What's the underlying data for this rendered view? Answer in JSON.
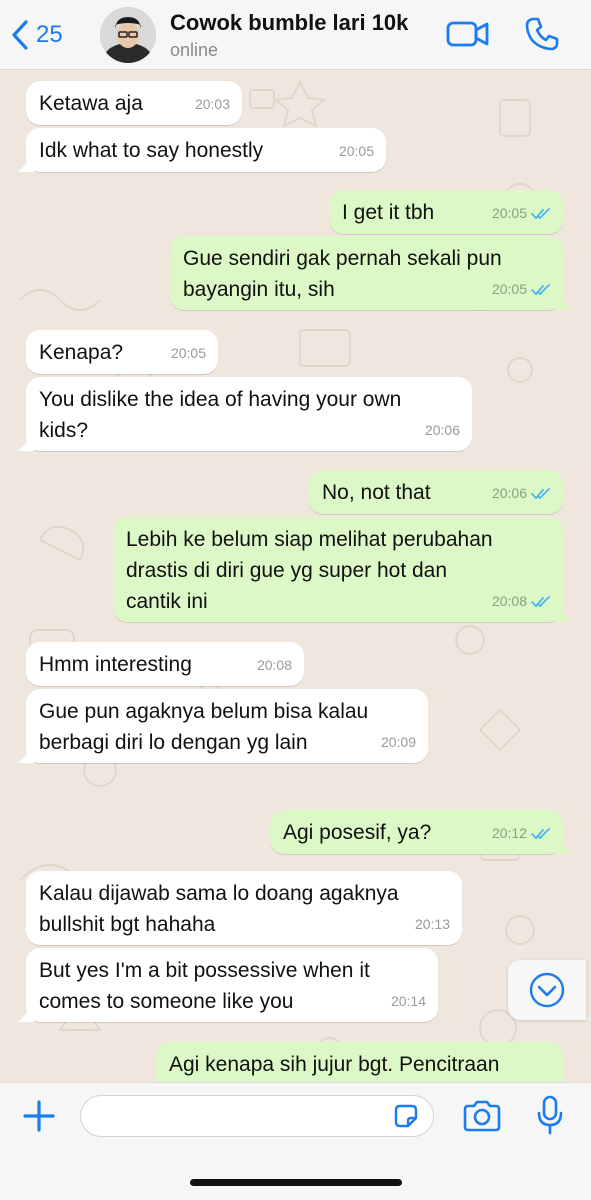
{
  "header": {
    "back_count": "25",
    "contact_name": "Cowok bumble lari 10k",
    "status": "online"
  },
  "colors": {
    "accent": "#1a7cf0",
    "outgoing_bubble": "#dcf8c6",
    "incoming_bubble": "#ffffff",
    "chat_background": "#efe7dd",
    "read_tick": "#4fb6ec"
  },
  "icons": {
    "back": "chevron-left-icon",
    "video": "video-camera-icon",
    "phone": "phone-icon",
    "scroll": "chevron-down-icon",
    "plus": "plus-icon",
    "sticker": "sticker-icon",
    "camera": "camera-icon",
    "mic": "microphone-icon"
  },
  "messages": [
    {
      "dir": "in",
      "text": "Ketawa aja",
      "time": "20:03"
    },
    {
      "dir": "in",
      "text": "Idk what to say honestly",
      "time": "20:05"
    },
    {
      "dir": "out",
      "text": "I get it tbh",
      "time": "20:05",
      "read": true
    },
    {
      "dir": "out",
      "text": "Gue sendiri gak pernah sekali pun\nbayangin itu, sih",
      "time": "20:05",
      "read": true
    },
    {
      "dir": "in",
      "text": "Kenapa?",
      "time": "20:05"
    },
    {
      "dir": "in",
      "text": "You dislike the idea of having your own\nkids?",
      "time": "20:06"
    },
    {
      "dir": "out",
      "text": "No, not that",
      "time": "20:06",
      "read": true
    },
    {
      "dir": "out",
      "text": "Lebih ke belum siap melihat perubahan\ndrastis di diri gue yg super hot dan\ncantik ini",
      "time": "20:08",
      "read": true
    },
    {
      "dir": "in",
      "text": "Hmm interesting",
      "time": "20:08"
    },
    {
      "dir": "in",
      "text": "Gue pun agaknya belum bisa kalau\nberbagi diri lo dengan yg lain",
      "time": "20:09"
    },
    {
      "dir": "out",
      "text": "Agi posesif, ya?",
      "time": "20:12",
      "read": true
    },
    {
      "dir": "in",
      "text": "Kalau dijawab sama lo doang agaknya\nbullshit bgt hahaha",
      "time": "20:13"
    },
    {
      "dir": "in",
      "text": "But yes I'm a bit possessive when it\ncomes to someone like you",
      "time": "20:14"
    },
    {
      "dir": "out",
      "text": "Agi kenapa sih jujur bgt. Pencitraan",
      "time": "",
      "read": false
    }
  ],
  "composer": {
    "value": "",
    "placeholder": ""
  }
}
